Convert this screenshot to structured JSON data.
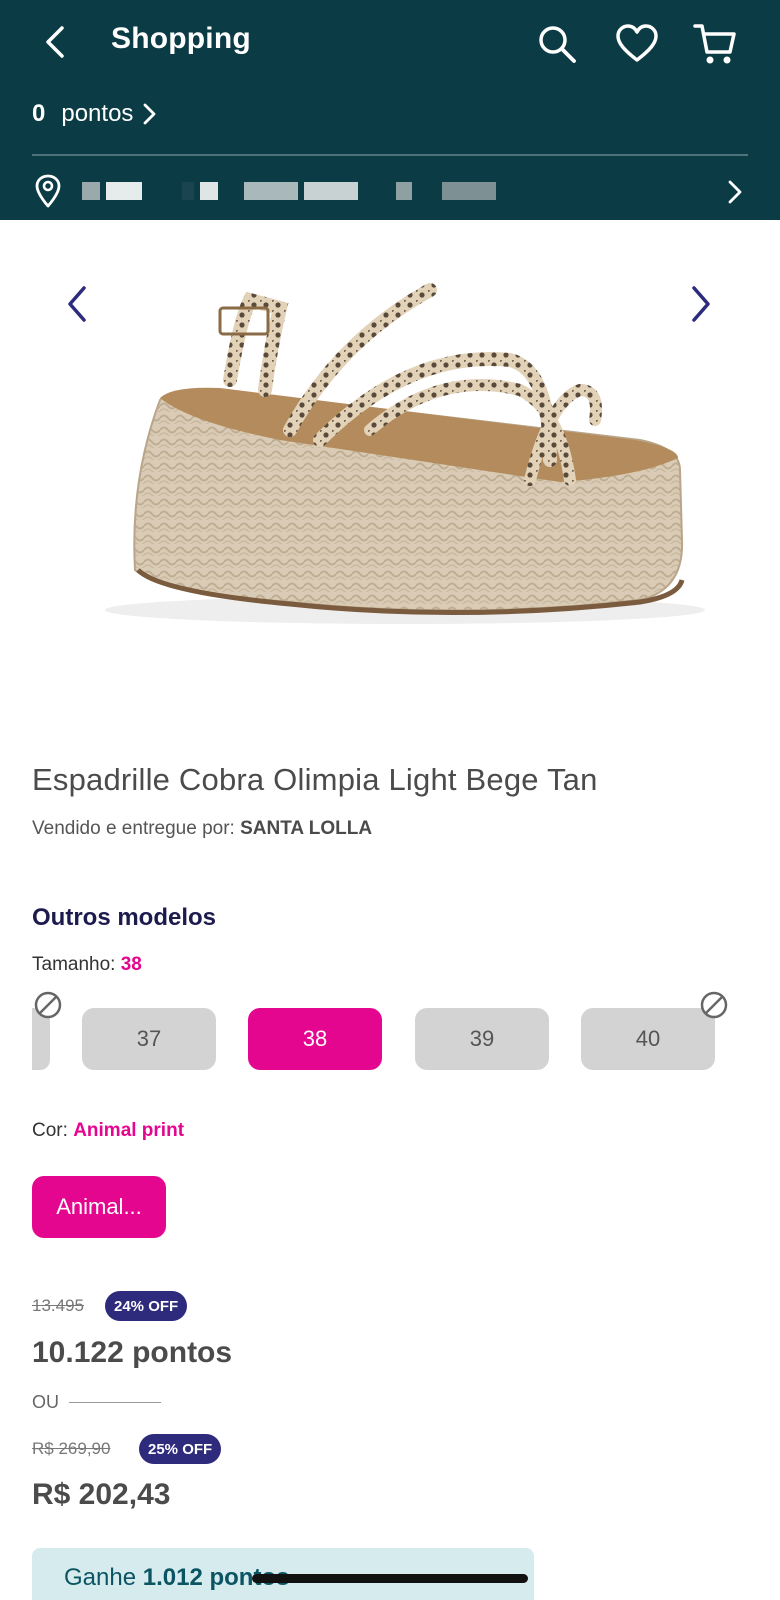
{
  "header": {
    "title": "Shopping",
    "points_value": "0",
    "points_label": "pontos",
    "location_text": "",
    "bg_color": "#0b3c45"
  },
  "icons": {
    "back": "back-arrow-icon",
    "search": "search-icon",
    "favorites": "heart-icon",
    "cart": "cart-icon",
    "location": "location-pin-icon"
  },
  "product": {
    "title": "Espadrille Cobra Olimpia Light Bege Tan",
    "sold_by_label": "Vendido e entregue por:",
    "seller": "SANTA LOLLA"
  },
  "models": {
    "title": "Outros modelos",
    "size_label": "Tamanho:",
    "size_selected": "38",
    "sizes": [
      {
        "label": "37",
        "selected": false
      },
      {
        "label": "38",
        "selected": true
      },
      {
        "label": "39",
        "selected": false
      },
      {
        "label": "40",
        "selected": false
      }
    ],
    "color_label": "Cor:",
    "color_selected": "Animal print",
    "color_button": "Animal..."
  },
  "pricing": {
    "old_points": "13.495",
    "points_discount": "24% OFF",
    "points": "10.122 pontos",
    "or_label": "OU",
    "old_price": "R$ 269,90",
    "price_discount": "25% OFF",
    "price": "R$ 202,43",
    "earn_prefix": "Ganhe",
    "earn_points": "1.012 pontos"
  },
  "colors": {
    "accent": "#e4068f",
    "badge": "#2e2a7c",
    "heading": "#1d1a4e",
    "earn_bg": "#d5ebee"
  }
}
